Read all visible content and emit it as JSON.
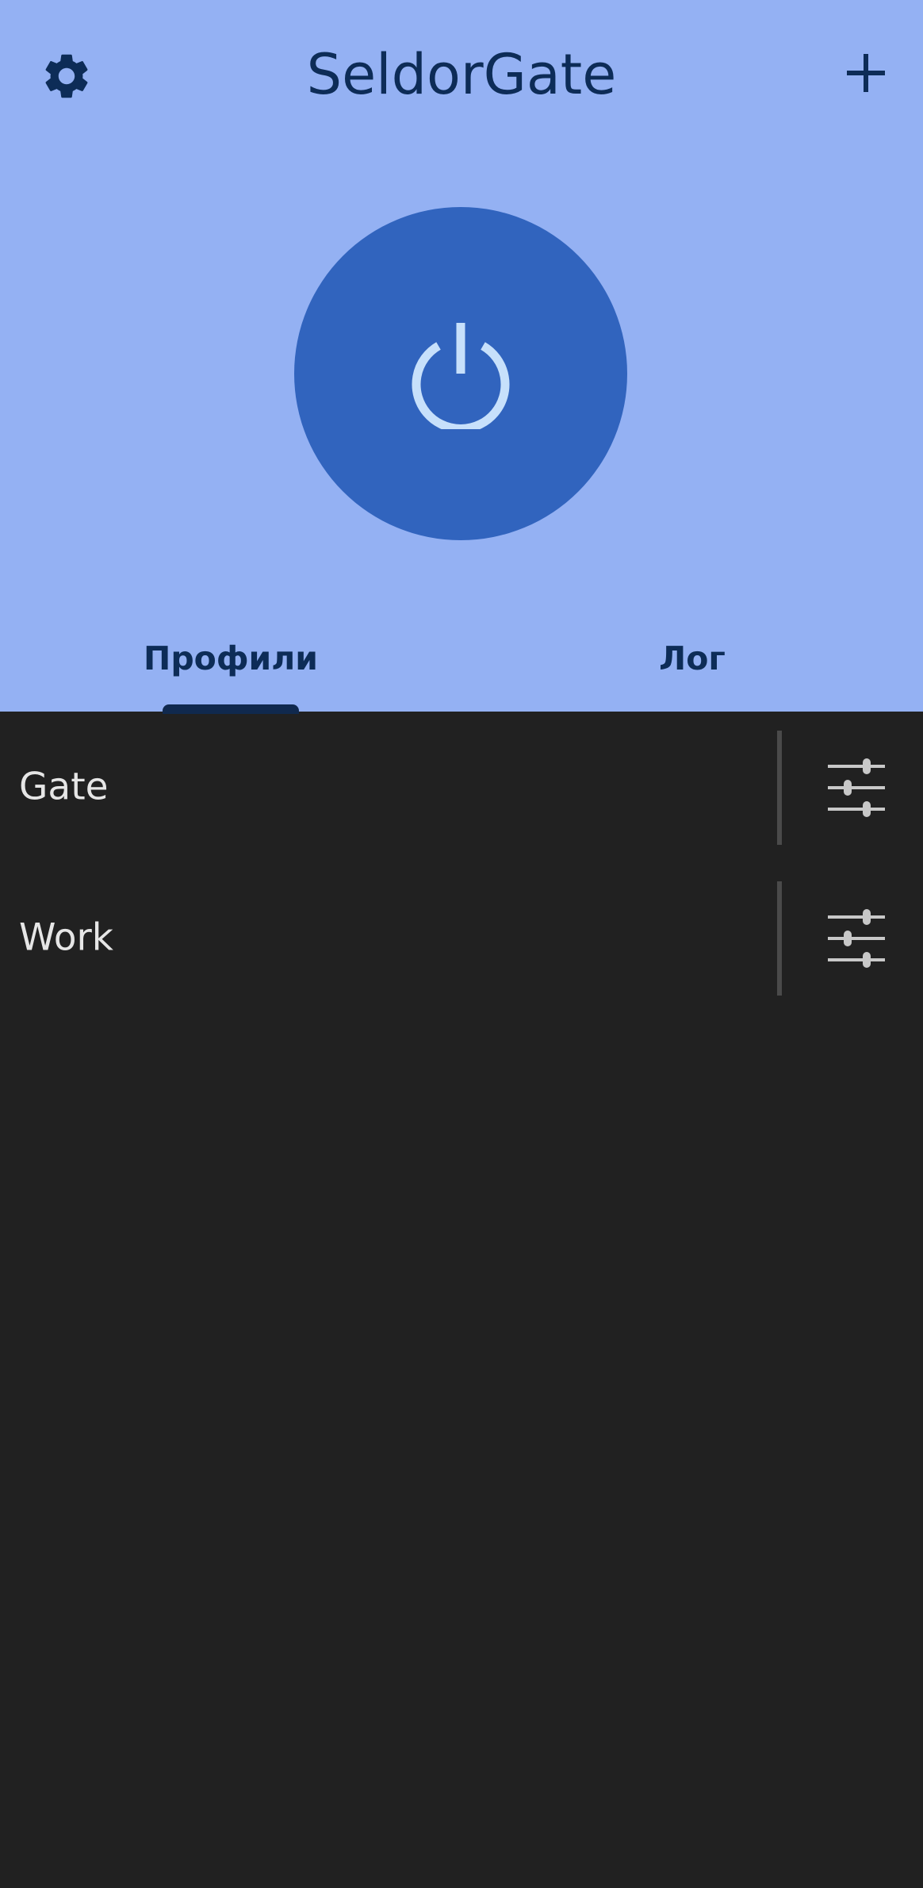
{
  "header": {
    "title": "SeldorGate",
    "settings_icon": "gear-icon",
    "add_icon": "plus-icon",
    "power_icon": "power-icon",
    "colors": {
      "header_bg": "#94b1f3",
      "power_button": "#3164be",
      "power_glyph": "#c7e0fb",
      "text_dark": "#0d2c57",
      "list_bg": "#212121"
    }
  },
  "tabs": [
    {
      "label": "Профили",
      "selected": true
    },
    {
      "label": "Лог",
      "selected": false
    }
  ],
  "profiles": [
    {
      "name": "Gate",
      "action_icon": "tune-icon"
    },
    {
      "name": "Work",
      "action_icon": "tune-icon"
    }
  ]
}
